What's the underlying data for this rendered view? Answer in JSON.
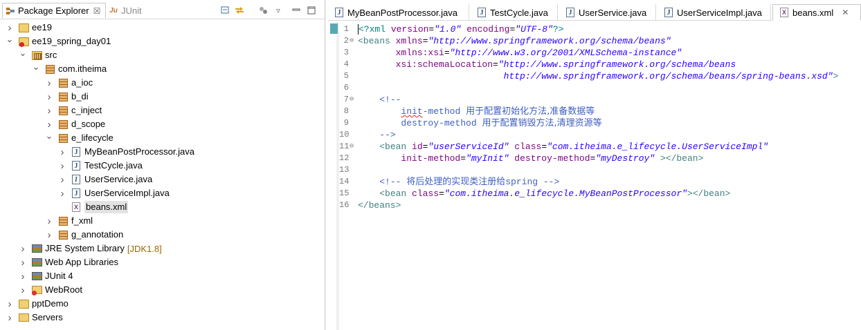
{
  "left_panel": {
    "tabs": [
      {
        "label": "Package Explorer",
        "active": true
      },
      {
        "label": "JUnit",
        "active": false
      }
    ],
    "tree": [
      {
        "label": "ee19",
        "depth": 0,
        "expanded": false,
        "icon": "project-icon"
      },
      {
        "label": "ee19_spring_day01",
        "depth": 0,
        "expanded": true,
        "icon": "project-error-icon"
      },
      {
        "label": "src",
        "depth": 1,
        "expanded": true,
        "icon": "source-folder-icon"
      },
      {
        "label": "com.itheima",
        "depth": 2,
        "expanded": true,
        "icon": "package-icon"
      },
      {
        "label": "a_ioc",
        "depth": 3,
        "expanded": false,
        "icon": "package-icon"
      },
      {
        "label": "b_di",
        "depth": 3,
        "expanded": false,
        "icon": "package-icon"
      },
      {
        "label": "c_inject",
        "depth": 3,
        "expanded": false,
        "icon": "package-icon"
      },
      {
        "label": "d_scope",
        "depth": 3,
        "expanded": false,
        "icon": "package-icon"
      },
      {
        "label": "e_lifecycle",
        "depth": 3,
        "expanded": true,
        "icon": "package-icon"
      },
      {
        "label": "MyBeanPostProcessor.java",
        "depth": 4,
        "expanded": false,
        "icon": "java-file-icon"
      },
      {
        "label": "TestCycle.java",
        "depth": 4,
        "expanded": false,
        "icon": "java-file-icon"
      },
      {
        "label": "UserService.java",
        "depth": 4,
        "expanded": false,
        "icon": "java-interface-icon"
      },
      {
        "label": "UserServiceImpl.java",
        "depth": 4,
        "expanded": false,
        "icon": "java-file-icon"
      },
      {
        "label": "beans.xml",
        "depth": 4,
        "expanded": null,
        "icon": "xml-file-icon",
        "selected": true
      },
      {
        "label": "f_xml",
        "depth": 3,
        "expanded": false,
        "icon": "package-icon"
      },
      {
        "label": "g_annotation",
        "depth": 3,
        "expanded": false,
        "icon": "package-icon"
      },
      {
        "label": "JRE System Library",
        "decoration": "[JDK1.8]",
        "depth": 1,
        "expanded": false,
        "icon": "library-icon"
      },
      {
        "label": "Web App Libraries",
        "depth": 1,
        "expanded": false,
        "icon": "library-icon"
      },
      {
        "label": "JUnit 4",
        "depth": 1,
        "expanded": false,
        "icon": "library-icon"
      },
      {
        "label": "WebRoot",
        "depth": 1,
        "expanded": false,
        "icon": "web-folder-icon"
      },
      {
        "label": "pptDemo",
        "depth": 0,
        "expanded": false,
        "icon": "project-icon"
      },
      {
        "label": "Servers",
        "depth": 0,
        "expanded": false,
        "icon": "folder-icon"
      }
    ]
  },
  "editor": {
    "tabs": [
      {
        "label": "MyBeanPostProcessor.java",
        "icon": "java-file-icon",
        "active": false
      },
      {
        "label": "TestCycle.java",
        "icon": "java-file-icon",
        "active": false
      },
      {
        "label": "UserService.java",
        "icon": "java-file-icon",
        "active": false
      },
      {
        "label": "UserServiceImpl.java",
        "icon": "java-file-icon",
        "active": false
      },
      {
        "label": "beans.xml",
        "icon": "xml-file-icon",
        "active": true
      }
    ],
    "lines": [
      {
        "n": "1",
        "fold": "",
        "tokens": [
          [
            "pi",
            "<?xml "
          ],
          [
            "attr",
            "version"
          ],
          [
            "t",
            "="
          ],
          [
            "str",
            "\"1.0\""
          ],
          [
            "t",
            " "
          ],
          [
            "attr",
            "encoding"
          ],
          [
            "t",
            "="
          ],
          [
            "str",
            "\"UTF-8\""
          ],
          [
            "pi",
            "?>"
          ]
        ]
      },
      {
        "n": "2",
        "fold": "⊖",
        "tokens": [
          [
            "tag",
            "<beans "
          ],
          [
            "attr",
            "xmlns"
          ],
          [
            "t",
            "="
          ],
          [
            "str",
            "\"http://www.springframework.org/schema/beans\""
          ]
        ]
      },
      {
        "n": "3",
        "fold": "",
        "tokens": [
          [
            "t",
            "       "
          ],
          [
            "attr",
            "xmlns:xsi"
          ],
          [
            "t",
            "="
          ],
          [
            "str",
            "\"http://www.w3.org/2001/XMLSchema-instance\""
          ]
        ]
      },
      {
        "n": "4",
        "fold": "",
        "tokens": [
          [
            "t",
            "       "
          ],
          [
            "attr",
            "xsi:schemaLocation"
          ],
          [
            "t",
            "="
          ],
          [
            "str",
            "\"http://www.springframework.org/schema/beans"
          ]
        ]
      },
      {
        "n": "5",
        "fold": "",
        "tokens": [
          [
            "t",
            "                           "
          ],
          [
            "str",
            "http://www.springframework.org/schema/beans/spring-beans.xsd\""
          ],
          [
            "tag",
            ">"
          ]
        ]
      },
      {
        "n": "6",
        "fold": "",
        "tokens": []
      },
      {
        "n": "7",
        "fold": "⊖",
        "tokens": [
          [
            "t",
            "    "
          ],
          [
            "com",
            "<!--"
          ]
        ]
      },
      {
        "n": "8",
        "fold": "",
        "tokens": [
          [
            "t",
            "        "
          ],
          [
            "com-sq",
            "init"
          ],
          [
            "com",
            "-method "
          ],
          [
            "com-cjk",
            "用于配置初始化方法,准备数据等"
          ]
        ]
      },
      {
        "n": "9",
        "fold": "",
        "tokens": [
          [
            "t",
            "        "
          ],
          [
            "com",
            "destroy-method "
          ],
          [
            "com-cjk",
            "用于配置销毁方法,清理资源等"
          ]
        ]
      },
      {
        "n": "10",
        "fold": "",
        "tokens": [
          [
            "t",
            "    "
          ],
          [
            "com",
            "-->"
          ]
        ]
      },
      {
        "n": "11",
        "fold": "⊖",
        "tokens": [
          [
            "t",
            "    "
          ],
          [
            "tag",
            "<bean "
          ],
          [
            "attr",
            "id"
          ],
          [
            "t",
            "="
          ],
          [
            "str",
            "\"userServiceId\""
          ],
          [
            "t",
            " "
          ],
          [
            "attr",
            "class"
          ],
          [
            "t",
            "="
          ],
          [
            "str",
            "\"com.itheima.e_lifecycle.UserServiceImpl\""
          ]
        ]
      },
      {
        "n": "12",
        "fold": "",
        "tokens": [
          [
            "t",
            "        "
          ],
          [
            "attr",
            "init-method"
          ],
          [
            "t",
            "="
          ],
          [
            "str",
            "\"myInit\""
          ],
          [
            "t",
            " "
          ],
          [
            "attr",
            "destroy-method"
          ],
          [
            "t",
            "="
          ],
          [
            "str",
            "\"myDestroy\""
          ],
          [
            "t",
            " "
          ],
          [
            "tag",
            "></bean>"
          ]
        ]
      },
      {
        "n": "13",
        "fold": "",
        "tokens": []
      },
      {
        "n": "14",
        "fold": "",
        "tokens": [
          [
            "t",
            "    "
          ],
          [
            "com",
            "<!-- "
          ],
          [
            "com-cjk",
            "将后处理的实现类注册给"
          ],
          [
            "com",
            "spring -->"
          ]
        ]
      },
      {
        "n": "15",
        "fold": "",
        "tokens": [
          [
            "t",
            "    "
          ],
          [
            "tag",
            "<bean "
          ],
          [
            "attr",
            "class"
          ],
          [
            "t",
            "="
          ],
          [
            "str",
            "\"com.itheima.e_lifecycle.MyBeanPostProcessor\""
          ],
          [
            "tag",
            "></bean>"
          ]
        ]
      },
      {
        "n": "16",
        "fold": "",
        "tokens": [
          [
            "tag",
            "</beans>"
          ]
        ]
      }
    ]
  }
}
